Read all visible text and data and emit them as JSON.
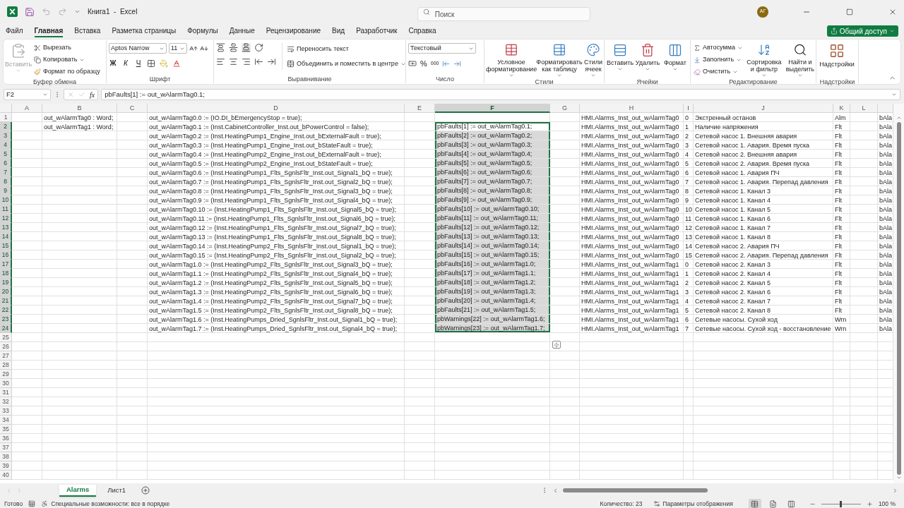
{
  "title_bar": {
    "title": "Книга1  -  Excel",
    "search": {
      "placeholder": "Поиск"
    },
    "avatar": "АГ"
  },
  "menu_tabs": [
    {
      "label": "Файл",
      "selected": false
    },
    {
      "label": "Главная",
      "selected": true
    },
    {
      "label": "Вставка",
      "selected": false
    },
    {
      "label": "Разметка страницы",
      "selected": false
    },
    {
      "label": "Формулы",
      "selected": false
    },
    {
      "label": "Данные",
      "selected": false
    },
    {
      "label": "Рецензирование",
      "selected": false
    },
    {
      "label": "Вид",
      "selected": false
    },
    {
      "label": "Разработчик",
      "selected": false
    },
    {
      "label": "Справка",
      "selected": false
    }
  ],
  "share_button": "Общий доступ",
  "ribbon": {
    "groups": [
      {
        "label": "Буфер обмена",
        "items": [
          {
            "label": "Вставить",
            "disabled": true
          },
          {
            "label": "Вырезать",
            "disabled": false
          },
          {
            "label": "Копировать",
            "disabled": false
          },
          {
            "label": "Формат по образцу",
            "disabled": false
          }
        ]
      },
      {
        "label": "Шрифт",
        "font_field": {
          "value": "Aptos Narrow"
        },
        "size_field": {
          "value": "11"
        },
        "items": [
          {
            "label": "Ж",
            "disabled": false
          },
          {
            "label": "К",
            "disabled": false
          },
          {
            "label": "Ч",
            "disabled": false
          }
        ]
      },
      {
        "label": "Выравнивание",
        "items": [
          {
            "label": "Переносить текст",
            "disabled": false
          },
          {
            "label": "Объединить и поместить в центре",
            "disabled": false
          }
        ]
      },
      {
        "label": "Число",
        "format_field": {
          "value": "Текстовый"
        },
        "items": [
          {
            "label": "%",
            "disabled": false
          },
          {
            "label": "000",
            "disabled": false
          }
        ]
      },
      {
        "label": "Стили",
        "items": [
          {
            "label": "Условное форматирование",
            "disabled": false
          },
          {
            "label": "Форматировать как таблицу",
            "disabled": false
          },
          {
            "label": "Стили ячеек",
            "disabled": false
          }
        ]
      },
      {
        "label": "Ячейки",
        "items": [
          {
            "label": "Вставить",
            "disabled": false
          },
          {
            "label": "Удалить",
            "disabled": false
          },
          {
            "label": "Формат",
            "disabled": false
          }
        ]
      },
      {
        "label": "Редактирование",
        "items": [
          {
            "label": "Автосумма",
            "disabled": false
          },
          {
            "label": "Заполнить",
            "disabled": false
          },
          {
            "label": "Очистить",
            "disabled": false
          },
          {
            "label": "Сортировка и фильтр",
            "disabled": false
          },
          {
            "label": "Найти и выделить",
            "disabled": false
          }
        ]
      },
      {
        "label": "Надстройки",
        "items": [
          {
            "label": "Надстройки",
            "disabled": false
          }
        ]
      }
    ]
  },
  "formula_bar": {
    "name_box": "F2",
    "function_label": "fx",
    "formula": "pbFaults[1] := out_wAlarmTag0.1;"
  },
  "sheet": {
    "columns": [
      {
        "header": "A",
        "selected": false
      },
      {
        "header": "B",
        "selected": false
      },
      {
        "header": "C",
        "selected": false
      },
      {
        "header": "D",
        "selected": false
      },
      {
        "header": "E",
        "selected": false
      },
      {
        "header": "F",
        "selected": true
      },
      {
        "header": "G",
        "selected": false
      },
      {
        "header": "H",
        "selected": false
      },
      {
        "header": "I",
        "selected": false
      },
      {
        "header": "J",
        "selected": false
      },
      {
        "header": "K",
        "selected": false
      },
      {
        "header": "L",
        "selected": false
      },
      {
        "selected": false
      }
    ],
    "rows": [
      {
        "number": "1",
        "selected": false,
        "cells": {
          "B": "out_wAlarmTag0 : Word;",
          "D": "out_wAlarmTag0.0 := (IO.DI_bEmergencyStop = true);",
          "H": "HMI.Alarms_Inst_out_wAlarmTag0",
          "I": "0",
          "J": "Экстренный останов",
          "K": "Alm",
          "M": "bAla"
        }
      },
      {
        "number": "2",
        "selected": true,
        "cells": {
          "B": "out_wAlarmTag1 : Word;",
          "D": "out_wAlarmTag0.1 := (Inst.CabinetController_Inst.out_bPowerControl = false);",
          "F": "pbFaults[1] := out_wAlarmTag0.1;",
          "H": "HMI.Alarms_Inst_out_wAlarmTag0",
          "I": "1",
          "J": "Наличие напряжения",
          "K": "Flt",
          "M": "bAla"
        }
      },
      {
        "number": "3",
        "selected": true,
        "cells": {
          "D": "out_wAlarmTag0.2 := (Inst.HeatingPump1_Engine_Inst.out_bExternalFault = true);",
          "F": "pbFaults[2] := out_wAlarmTag0.2;",
          "H": "HMI.Alarms_Inst_out_wAlarmTag0",
          "I": "2",
          "J": "Сетевой насос 1. Внешняя авария",
          "K": "Flt",
          "M": "bAla"
        }
      },
      {
        "number": "4",
        "selected": true,
        "cells": {
          "D": "out_wAlarmTag0.3 := (Inst.HeatingPump1_Engine_Inst.out_bStateFault = true);",
          "F": "pbFaults[3] := out_wAlarmTag0.3;",
          "H": "HMI.Alarms_Inst_out_wAlarmTag0",
          "I": "3",
          "J": "Сетевой насос 1. Авария. Время пуска",
          "K": "Flt",
          "M": "bAla"
        }
      },
      {
        "number": "5",
        "selected": true,
        "cells": {
          "D": "out_wAlarmTag0.4 := (Inst.HeatingPump2_Engine_Inst.out_bExternalFault = true);",
          "F": "pbFaults[4] := out_wAlarmTag0.4;",
          "H": "HMI.Alarms_Inst_out_wAlarmTag0",
          "I": "4",
          "J": "Сетевой насос 2. Внешняя авария",
          "K": "Flt",
          "M": "bAla"
        }
      },
      {
        "number": "6",
        "selected": true,
        "cells": {
          "D": "out_wAlarmTag0.5 := (Inst.HeatingPump2_Engine_Inst.out_bStateFault = true);",
          "F": "pbFaults[5] := out_wAlarmTag0.5;",
          "H": "HMI.Alarms_Inst_out_wAlarmTag0",
          "I": "5",
          "J": "Сетевой насос 2. Авария. Время пуска",
          "K": "Flt",
          "M": "bAla"
        }
      },
      {
        "number": "7",
        "selected": true,
        "cells": {
          "D": "out_wAlarmTag0.6 := (Inst.HeatingPump1_Flts_SgnlsFltr_Inst.out_Signal1_bQ = true);",
          "F": "pbFaults[6] := out_wAlarmTag0.6;",
          "H": "HMI.Alarms_Inst_out_wAlarmTag0",
          "I": "6",
          "J": "Сетевой насос 1. Авария ПЧ",
          "K": "Flt",
          "M": "bAla"
        }
      },
      {
        "number": "8",
        "selected": true,
        "cells": {
          "D": "out_wAlarmTag0.7 := (Inst.HeatingPump1_Flts_SgnlsFltr_Inst.out_Signal2_bQ = true);",
          "F": "pbFaults[7] := out_wAlarmTag0.7;",
          "H": "HMI.Alarms_Inst_out_wAlarmTag0",
          "I": "7",
          "J": "Сетевой насос 1. Авария. Перепад давления",
          "K": "Flt",
          "M": "bAla"
        }
      },
      {
        "number": "9",
        "selected": true,
        "cells": {
          "D": "out_wAlarmTag0.8 := (Inst.HeatingPump1_Flts_SgnlsFltr_Inst.out_Signal3_bQ = true);",
          "F": "pbFaults[8] := out_wAlarmTag0.8;",
          "H": "HMI.Alarms_Inst_out_wAlarmTag0",
          "I": "8",
          "J": "Сетевой насос 1. Канал 3",
          "K": "Flt",
          "M": "bAla"
        }
      },
      {
        "number": "10",
        "selected": true,
        "cells": {
          "D": "out_wAlarmTag0.9 := (Inst.HeatingPump1_Flts_SgnlsFltr_Inst.out_Signal4_bQ = true);",
          "F": "pbFaults[9] := out_wAlarmTag0.9;",
          "H": "HMI.Alarms_Inst_out_wAlarmTag0",
          "I": "9",
          "J": "Сетевой насос 1. Канал 4",
          "K": "Flt",
          "M": "bAla"
        }
      },
      {
        "number": "11",
        "selected": true,
        "cells": {
          "D": "out_wAlarmTag0.10 := (Inst.HeatingPump1_Flts_SgnlsFltr_Inst.out_Signal5_bQ = true);",
          "F": "pbFaults[10] := out_wAlarmTag0.10;",
          "H": "HMI.Alarms_Inst_out_wAlarmTag0",
          "I": "10",
          "J": "Сетевой насос 1. Канал 5",
          "K": "Flt",
          "M": "bAla"
        }
      },
      {
        "number": "12",
        "selected": true,
        "cells": {
          "D": "out_wAlarmTag0.11 := (Inst.HeatingPump1_Flts_SgnlsFltr_Inst.out_Signal6_bQ = true);",
          "F": "pbFaults[11] := out_wAlarmTag0.11;",
          "H": "HMI.Alarms_Inst_out_wAlarmTag0",
          "I": "11",
          "J": "Сетевой насос 1. Канал 6",
          "K": "Flt",
          "M": "bAla"
        }
      },
      {
        "number": "13",
        "selected": true,
        "cells": {
          "D": "out_wAlarmTag0.12 := (Inst.HeatingPump1_Flts_SgnlsFltr_Inst.out_Signal7_bQ = true);",
          "F": "pbFaults[12] := out_wAlarmTag0.12;",
          "H": "HMI.Alarms_Inst_out_wAlarmTag0",
          "I": "12",
          "J": "Сетевой насос 1. Канал 7",
          "K": "Flt",
          "M": "bAla"
        }
      },
      {
        "number": "14",
        "selected": true,
        "cells": {
          "D": "out_wAlarmTag0.13 := (Inst.HeatingPump1_Flts_SgnlsFltr_Inst.out_Signal8_bQ = true);",
          "F": "pbFaults[13] := out_wAlarmTag0.13;",
          "H": "HMI.Alarms_Inst_out_wAlarmTag0",
          "I": "13",
          "J": "Сетевой насос 1. Канал 8",
          "K": "Flt",
          "M": "bAla"
        }
      },
      {
        "number": "15",
        "selected": true,
        "cells": {
          "D": "out_wAlarmTag0.14 := (Inst.HeatingPump2_Flts_SgnlsFltr_Inst.out_Signal1_bQ = true);",
          "F": "pbFaults[14] := out_wAlarmTag0.14;",
          "H": "HMI.Alarms_Inst_out_wAlarmTag0",
          "I": "14",
          "J": "Сетевой насос 2. Авария ПЧ",
          "K": "Flt",
          "M": "bAla"
        }
      },
      {
        "number": "16",
        "selected": true,
        "cells": {
          "D": "out_wAlarmTag0.15 := (Inst.HeatingPump2_Flts_SgnlsFltr_Inst.out_Signal2_bQ = true);",
          "F": "pbFaults[15] := out_wAlarmTag0.15;",
          "H": "HMI.Alarms_Inst_out_wAlarmTag0",
          "I": "15",
          "J": "Сетевой насос 2. Авария. Перепад давления",
          "K": "Flt",
          "M": "bAla"
        }
      },
      {
        "number": "17",
        "selected": true,
        "cells": {
          "D": "out_wAlarmTag1.0 := (Inst.HeatingPump2_Flts_SgnlsFltr_Inst.out_Signal3_bQ = true);",
          "F": "pbFaults[16] := out_wAlarmTag1.0;",
          "H": "HMI.Alarms_Inst_out_wAlarmTag1",
          "I": "0",
          "J": "Сетевой насос 2. Канал 3",
          "K": "Flt",
          "M": "bAla"
        }
      },
      {
        "number": "18",
        "selected": true,
        "cells": {
          "D": "out_wAlarmTag1.1 := (Inst.HeatingPump2_Flts_SgnlsFltr_Inst.out_Signal4_bQ = true);",
          "F": "pbFaults[17] := out_wAlarmTag1.1;",
          "H": "HMI.Alarms_Inst_out_wAlarmTag1",
          "I": "1",
          "J": "Сетевой насос 2. Канал 4",
          "K": "Flt",
          "M": "bAla"
        }
      },
      {
        "number": "19",
        "selected": true,
        "cells": {
          "D": "out_wAlarmTag1.2 := (Inst.HeatingPump2_Flts_SgnlsFltr_Inst.out_Signal5_bQ = true);",
          "F": "pbFaults[18] := out_wAlarmTag1.2;",
          "H": "HMI.Alarms_Inst_out_wAlarmTag1",
          "I": "2",
          "J": "Сетевой насос 2. Канал 5",
          "K": "Flt",
          "M": "bAla"
        }
      },
      {
        "number": "20",
        "selected": true,
        "cells": {
          "D": "out_wAlarmTag1.3 := (Inst.HeatingPump2_Flts_SgnlsFltr_Inst.out_Signal6_bQ = true);",
          "F": "pbFaults[19] := out_wAlarmTag1.3;",
          "H": "HMI.Alarms_Inst_out_wAlarmTag1",
          "I": "3",
          "J": "Сетевой насос 2. Канал 6",
          "K": "Flt",
          "M": "bAla"
        }
      },
      {
        "number": "21",
        "selected": true,
        "cells": {
          "D": "out_wAlarmTag1.4 := (Inst.HeatingPump2_Flts_SgnlsFltr_Inst.out_Signal7_bQ = true);",
          "F": "pbFaults[20] := out_wAlarmTag1.4;",
          "H": "HMI.Alarms_Inst_out_wAlarmTag1",
          "I": "4",
          "J": "Сетевой насос 2. Канал 7",
          "K": "Flt",
          "M": "bAla"
        }
      },
      {
        "number": "22",
        "selected": true,
        "cells": {
          "D": "out_wAlarmTag1.5 := (Inst.HeatingPump2_Flts_SgnlsFltr_Inst.out_Signal8_bQ = true);",
          "F": "pbFaults[21] := out_wAlarmTag1.5;",
          "H": "HMI.Alarms_Inst_out_wAlarmTag1",
          "I": "5",
          "J": "Сетевой насос 2. Канал 8",
          "K": "Flt",
          "M": "bAla"
        }
      },
      {
        "number": "23",
        "selected": true,
        "cells": {
          "D": "out_wAlarmTag1.6 := (Inst.HeatingPumps_Dried_SgnlsFltr_Inst.out_Signal1_bQ = true);",
          "F": "pbWarnings[22] := out_wAlarmTag1.6;",
          "H": "HMI.Alarms_Inst_out_wAlarmTag1",
          "I": "6",
          "J": "Сетевые насосы. Сухой ход",
          "K": "Wrn",
          "M": "bAla"
        }
      },
      {
        "number": "24",
        "selected": true,
        "cells": {
          "D": "out_wAlarmTag1.7 := (Inst.HeatingPumps_Dried_SgnlsFltr_Inst.out_Signal4_bQ = true);",
          "F": "pbWarnings[23] := out_wAlarmTag1.7;",
          "H": "HMI.Alarms_Inst_out_wAlarmTag1",
          "I": "7",
          "J": "Сетевые насосы. Сухой ход - восстановление",
          "K": "Wrn",
          "M": "bAla"
        }
      },
      {
        "number": "25",
        "selected": false
      },
      {
        "number": "26",
        "selected": false
      },
      {
        "number": "27",
        "selected": false
      },
      {
        "number": "28",
        "selected": false
      },
      {
        "number": "29",
        "selected": false
      },
      {
        "number": "30",
        "selected": false
      },
      {
        "number": "31",
        "selected": false
      },
      {
        "number": "32",
        "selected": false
      },
      {
        "number": "33",
        "selected": false
      },
      {
        "number": "34",
        "selected": false
      },
      {
        "number": "35",
        "selected": false
      },
      {
        "number": "36",
        "selected": false
      },
      {
        "number": "37",
        "selected": false
      },
      {
        "number": "38",
        "selected": false
      },
      {
        "number": "39",
        "selected": false
      },
      {
        "number": "40",
        "selected": false
      }
    ]
  },
  "sheet_tabs": [
    {
      "label": "Alarms",
      "selected": true
    },
    {
      "label": "Лист1",
      "selected": false
    }
  ],
  "status_bar": {
    "mode": "Готово",
    "accessibility": "Специальные возможности: все в порядке",
    "count": "Количество: 23",
    "display_settings": "Параметры отображения",
    "views": [
      {
        "selected": true
      },
      {
        "selected": false
      },
      {
        "selected": false
      }
    ],
    "zoom": {
      "level": 0.5,
      "reading": "100 %"
    }
  }
}
